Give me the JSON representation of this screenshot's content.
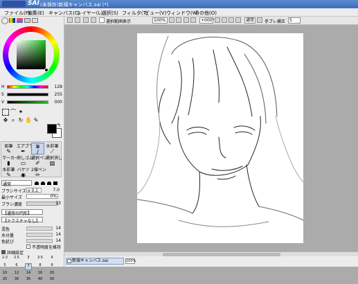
{
  "window": {
    "title": "(未保存)新規キャンバス.sai (*)",
    "app": "SAI"
  },
  "menu": [
    "ファイル(F)",
    "編集(E)",
    "キャンバス(C)",
    "レイヤー(L)",
    "選択(S)",
    "フィルタ(T)",
    "ビュー(V)",
    "ウィンドウ(W)",
    "その他(O)"
  ],
  "toolbar": {
    "selection_label": "選択範囲表示",
    "zoom": "100%",
    "angle": "+000°",
    "blend": "通常",
    "stabilizer_label": "手ブレ補正",
    "stabilizer": "5"
  },
  "color": {
    "h_label": "H",
    "h_value": "128",
    "s_label": "S",
    "s_value": "255",
    "v_label": "V",
    "v_value": "000",
    "foreground": "#000000",
    "background": "#ffffff"
  },
  "tools": [
    {
      "label": "鉛筆",
      "icon": "✎"
    },
    {
      "label": "エアブラ",
      "icon": "✒"
    },
    {
      "label": "筆",
      "icon": "/"
    },
    {
      "label": "水彩筆",
      "icon": "⟋"
    },
    {
      "label": "マーカー",
      "icon": "▮"
    },
    {
      "label": "消しゴム",
      "icon": "▭"
    },
    {
      "label": "選択ペン",
      "icon": "✐"
    },
    {
      "label": "選択消し",
      "icon": "▨"
    },
    {
      "label": "水彩筆",
      "icon": "✎"
    },
    {
      "label": "バケツ",
      "icon": "◉"
    },
    {
      "label": "2値ペン",
      "icon": "✏"
    }
  ],
  "brush": {
    "mode": "通常",
    "size_label": "ブラシサイズ",
    "size_multiplier": "x 0.1",
    "size_value": "7.0",
    "min_size_label": "最小サイズ",
    "min_size_value": "0%",
    "density_label": "ブラシ濃度",
    "density_value": "23",
    "edge_option": "【通常の円形】",
    "texture_option": "【テクスチャなし】",
    "blend_label": "混色",
    "blend_value": "14",
    "water_label": "水分量",
    "water_value": "14",
    "persist_label": "色延び",
    "persist_value": "14",
    "keep_opacity_label": "不透明度を維持",
    "detail_label": "詳細設定"
  },
  "size_presets": [
    "2.3",
    "2.5",
    "3",
    "3.5",
    "4",
    "5",
    "6",
    "7",
    "8",
    "9",
    "10",
    "12",
    "14",
    "16",
    "20",
    "25",
    "30",
    "35",
    "40",
    "50"
  ],
  "status": {
    "doc_name": "新規キャンバス.sai",
    "zoom": "100%"
  }
}
